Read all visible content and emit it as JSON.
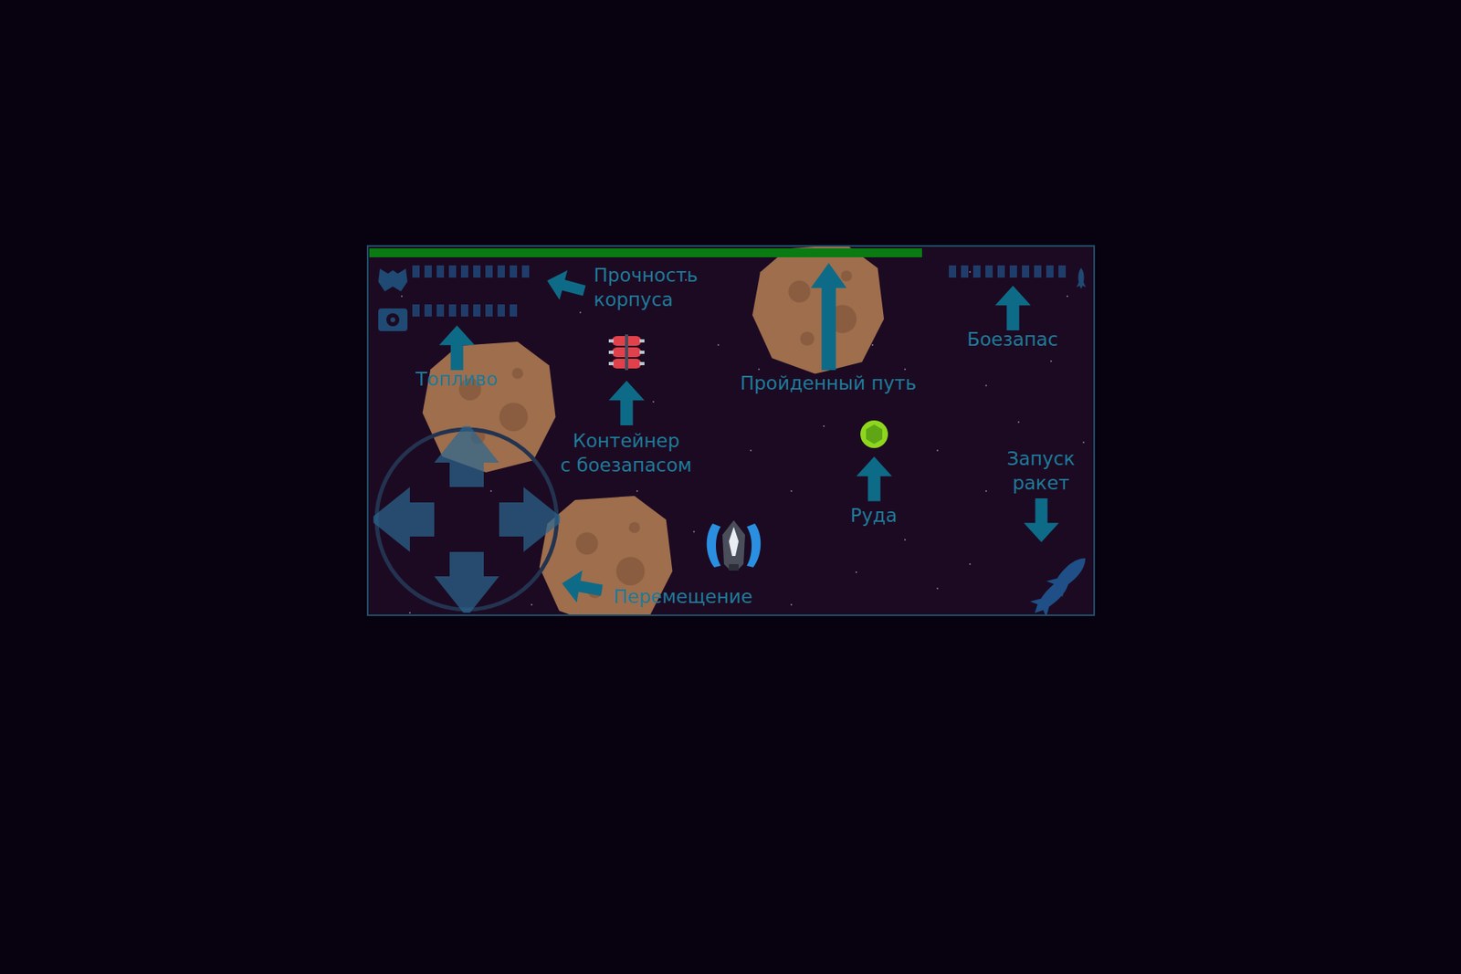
{
  "hud": {
    "distance": {
      "level": 0.765
    },
    "hull": {
      "segments": 10,
      "level": 1
    },
    "fuel": {
      "segments": 9,
      "level": 1
    },
    "ammo": {
      "segments": 10,
      "level": 1
    }
  },
  "callouts": {
    "hull": {
      "lines": [
        "Прочность",
        "корпуса"
      ]
    },
    "fuel": {
      "lines": [
        "Топливо"
      ]
    },
    "container": {
      "lines": [
        "Контейнер",
        "с боезапасом"
      ]
    },
    "distance": {
      "lines": [
        "Пройденный путь"
      ]
    },
    "ammo": {
      "lines": [
        "Боезапас"
      ]
    },
    "rockets": {
      "lines": [
        "Запуск",
        "ракет"
      ]
    },
    "ore": {
      "lines": [
        "Руда"
      ]
    },
    "movement": {
      "lines": [
        "Перемещение"
      ]
    }
  }
}
